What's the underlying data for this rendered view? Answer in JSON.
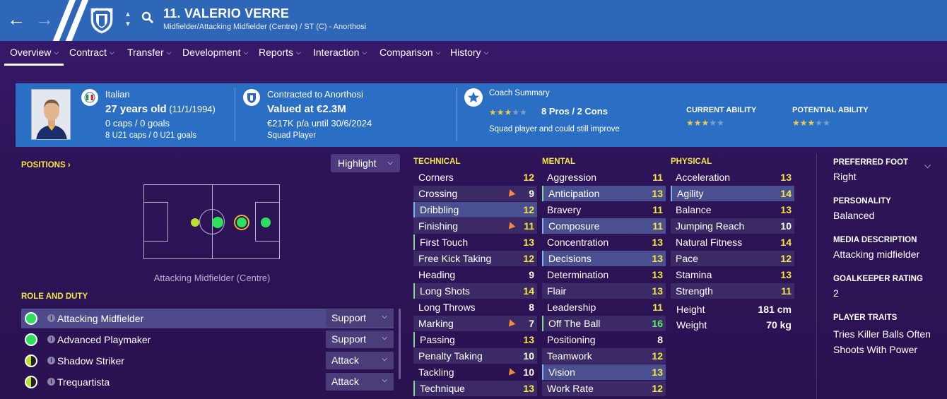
{
  "header": {
    "title": "11. VALERIO VERRE",
    "subtitle": "Midfielder/Attacking Midfielder (Centre) / ST (C) - Anorthosi"
  },
  "tabs": [
    {
      "label": "Overview"
    },
    {
      "label": "Contract"
    },
    {
      "label": "Transfer"
    },
    {
      "label": "Development"
    },
    {
      "label": "Reports"
    },
    {
      "label": "Interaction"
    },
    {
      "label": "Comparison"
    },
    {
      "label": "History"
    }
  ],
  "info": {
    "nationality": "Italian",
    "age": "27 years old",
    "dob": "(11/1/1994)",
    "caps": "0 caps / 0 goals",
    "u21caps": "8 U21 caps / 0 U21 goals",
    "contracted": "Contracted to Anorthosi",
    "valued": "Valued at €2.3M",
    "wage": "€217K p/a until 30/6/2024",
    "squad_status": "Squad Player",
    "coach_summary_label": "Coach Summary",
    "pros_cons": "8 Pros / 2 Cons",
    "coach_text": "Squad player and could still improve",
    "coach_stars": 3,
    "current_ability_label": "CURRENT ABILITY",
    "current_ability_stars": 3,
    "potential_ability_label": "POTENTIAL ABILITY",
    "potential_ability_stars": 3
  },
  "positions": {
    "label": "POSITIONS",
    "highlight_label": "Highlight",
    "selected_position": "Attacking Midfielder (Centre)"
  },
  "roles": {
    "label": "ROLE AND DUTY",
    "items": [
      {
        "name": "Attacking Midfielder",
        "duty": "Support"
      },
      {
        "name": "Advanced Playmaker",
        "duty": "Support"
      },
      {
        "name": "Shadow Striker",
        "duty": "Attack"
      },
      {
        "name": "Trequartista",
        "duty": "Attack"
      }
    ]
  },
  "technical": {
    "label": "TECHNICAL",
    "attrs": [
      {
        "name": "Corners",
        "value": "12"
      },
      {
        "name": "Crossing",
        "value": "9"
      },
      {
        "name": "Dribbling",
        "value": "12"
      },
      {
        "name": "Finishing",
        "value": "11"
      },
      {
        "name": "First Touch",
        "value": "13"
      },
      {
        "name": "Free Kick Taking",
        "value": "12"
      },
      {
        "name": "Heading",
        "value": "9"
      },
      {
        "name": "Long Shots",
        "value": "14"
      },
      {
        "name": "Long Throws",
        "value": "8"
      },
      {
        "name": "Marking",
        "value": "7"
      },
      {
        "name": "Passing",
        "value": "13"
      },
      {
        "name": "Penalty Taking",
        "value": "10"
      },
      {
        "name": "Tackling",
        "value": "10"
      },
      {
        "name": "Technique",
        "value": "13"
      }
    ]
  },
  "mental": {
    "label": "MENTAL",
    "attrs": [
      {
        "name": "Aggression",
        "value": "11"
      },
      {
        "name": "Anticipation",
        "value": "13"
      },
      {
        "name": "Bravery",
        "value": "11"
      },
      {
        "name": "Composure",
        "value": "11"
      },
      {
        "name": "Concentration",
        "value": "13"
      },
      {
        "name": "Decisions",
        "value": "13"
      },
      {
        "name": "Determination",
        "value": "13"
      },
      {
        "name": "Flair",
        "value": "13"
      },
      {
        "name": "Leadership",
        "value": "11"
      },
      {
        "name": "Off The Ball",
        "value": "16"
      },
      {
        "name": "Positioning",
        "value": "8"
      },
      {
        "name": "Teamwork",
        "value": "12"
      },
      {
        "name": "Vision",
        "value": "13"
      },
      {
        "name": "Work Rate",
        "value": "12"
      }
    ]
  },
  "physical": {
    "label": "PHYSICAL",
    "attrs": [
      {
        "name": "Acceleration",
        "value": "13"
      },
      {
        "name": "Agility",
        "value": "14"
      },
      {
        "name": "Balance",
        "value": "13"
      },
      {
        "name": "Jumping Reach",
        "value": "10"
      },
      {
        "name": "Natural Fitness",
        "value": "14"
      },
      {
        "name": "Pace",
        "value": "12"
      },
      {
        "name": "Stamina",
        "value": "13"
      },
      {
        "name": "Strength",
        "value": "11"
      }
    ],
    "height_label": "Height",
    "height": "181 cm",
    "weight_label": "Weight",
    "weight": "70 kg"
  },
  "side": {
    "preferred_foot_label": "PREFERRED FOOT",
    "preferred_foot": "Right",
    "personality_label": "PERSONALITY",
    "personality": "Balanced",
    "media_label": "MEDIA DESCRIPTION",
    "media": "Attacking midfielder",
    "gk_label": "GOALKEEPER RATING",
    "gk": "2",
    "traits_label": "PLAYER TRAITS",
    "traits": [
      "Tries Killer Balls Often",
      "Shoots With Power"
    ]
  },
  "colors": {
    "topbar": "#2e66b8",
    "infobar": "#2b6fc4",
    "background": "#2d1458",
    "attr_yellow": "#f5e642",
    "attr_green": "#5df06a",
    "star": "#f3c94a"
  }
}
